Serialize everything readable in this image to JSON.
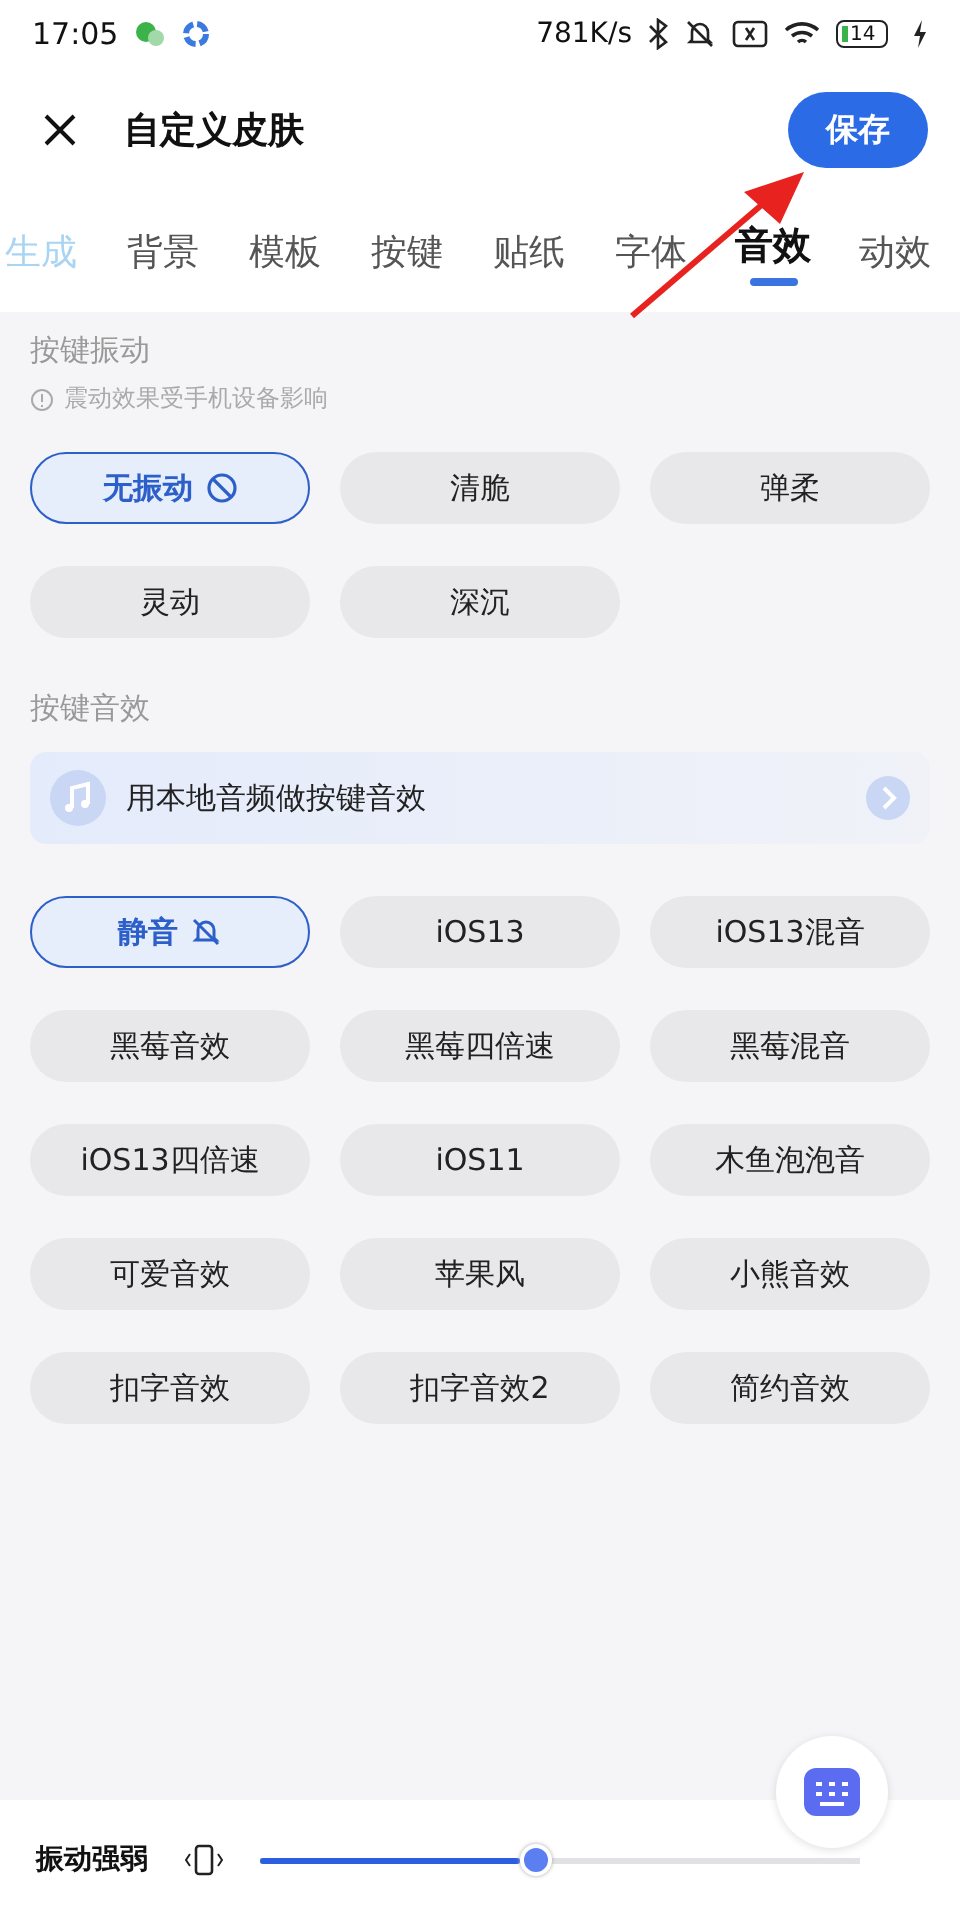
{
  "status_bar": {
    "time": "17:05",
    "speed": "781K/s",
    "battery": "14"
  },
  "header": {
    "title": "自定义皮肤",
    "save": "保存"
  },
  "tabs": [
    {
      "label": "生成",
      "selected": false,
      "faded": true
    },
    {
      "label": "背景",
      "selected": false,
      "faded": false
    },
    {
      "label": "模板",
      "selected": false,
      "faded": false
    },
    {
      "label": "按键",
      "selected": false,
      "faded": false
    },
    {
      "label": "贴纸",
      "selected": false,
      "faded": false
    },
    {
      "label": "字体",
      "selected": false,
      "faded": false
    },
    {
      "label": "音效",
      "selected": true,
      "faded": false
    },
    {
      "label": "动效",
      "selected": false,
      "faded": false
    }
  ],
  "vibration": {
    "title": "按键振动",
    "note": "震动效果受手机设备影响",
    "options": [
      {
        "label": "无振动",
        "selected": true,
        "kind": "off"
      },
      {
        "label": "清脆",
        "selected": false,
        "kind": "plain"
      },
      {
        "label": "弹柔",
        "selected": false,
        "kind": "plain"
      },
      {
        "label": "灵动",
        "selected": false,
        "kind": "plain"
      },
      {
        "label": "深沉",
        "selected": false,
        "kind": "plain"
      }
    ]
  },
  "sound": {
    "title": "按键音效",
    "local": "用本地音频做按键音效",
    "options": [
      {
        "label": "静音",
        "selected": true,
        "kind": "off"
      },
      {
        "label": "iOS13",
        "selected": false,
        "kind": "plain"
      },
      {
        "label": "iOS13混音",
        "selected": false,
        "kind": "plain"
      },
      {
        "label": "黑莓音效",
        "selected": false,
        "kind": "plain"
      },
      {
        "label": "黑莓四倍速",
        "selected": false,
        "kind": "plain"
      },
      {
        "label": "黑莓混音",
        "selected": false,
        "kind": "plain"
      },
      {
        "label": "iOS13四倍速",
        "selected": false,
        "kind": "plain"
      },
      {
        "label": "iOS11",
        "selected": false,
        "kind": "plain"
      },
      {
        "label": "木鱼泡泡音",
        "selected": false,
        "kind": "plain"
      },
      {
        "label": "可爱音效",
        "selected": false,
        "kind": "plain"
      },
      {
        "label": "苹果风",
        "selected": false,
        "kind": "plain"
      },
      {
        "label": "小熊音效",
        "selected": false,
        "kind": "plain"
      },
      {
        "label": "扣字音效",
        "selected": false,
        "kind": "plain"
      },
      {
        "label": "扣字音效2",
        "selected": false,
        "kind": "plain"
      },
      {
        "label": "简约音效",
        "selected": false,
        "kind": "plain"
      }
    ]
  },
  "strength": {
    "label": "振动强弱",
    "level": 0.46
  }
}
